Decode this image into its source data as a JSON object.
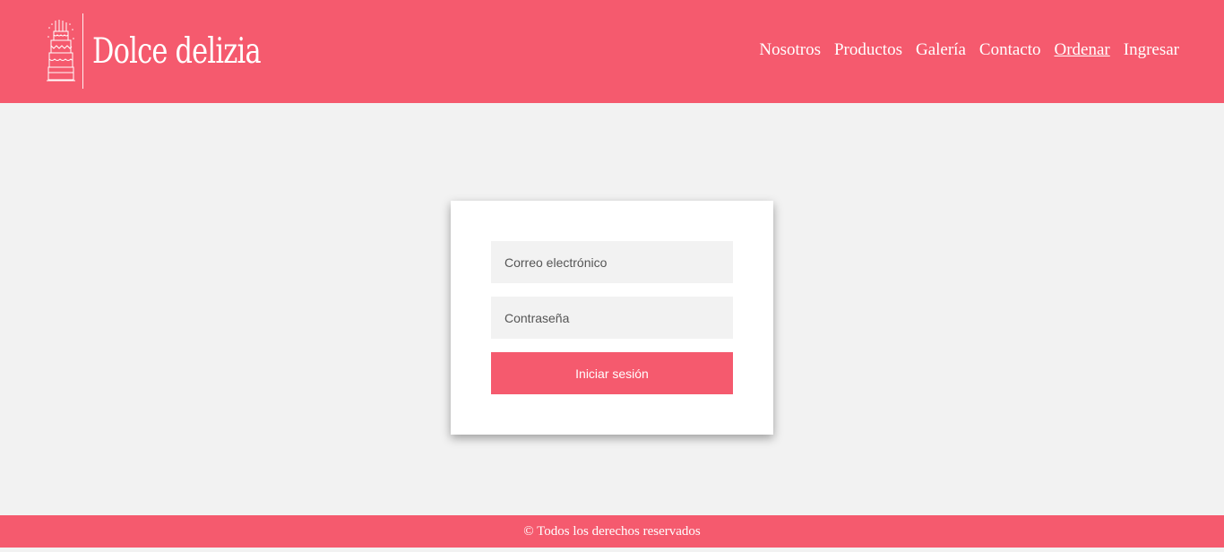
{
  "brand": {
    "name": "Dolce delizia",
    "icon": "cake-icon",
    "color": "#f55a6e"
  },
  "nav": {
    "items": [
      {
        "label": "Nosotros"
      },
      {
        "label": "Productos"
      },
      {
        "label": "Galería"
      },
      {
        "label": "Contacto"
      },
      {
        "label": "Ordenar"
      },
      {
        "label": "Ingresar"
      }
    ],
    "active": "Ordenar"
  },
  "login": {
    "email_placeholder": "Correo electrónico",
    "password_placeholder": "Contraseña",
    "submit_label": "Iniciar sesión"
  },
  "footer": {
    "text": "© Todos los derechos reservados"
  },
  "colors": {
    "accent": "#f55a6e",
    "background": "#f2f2f2",
    "card": "#ffffff"
  }
}
